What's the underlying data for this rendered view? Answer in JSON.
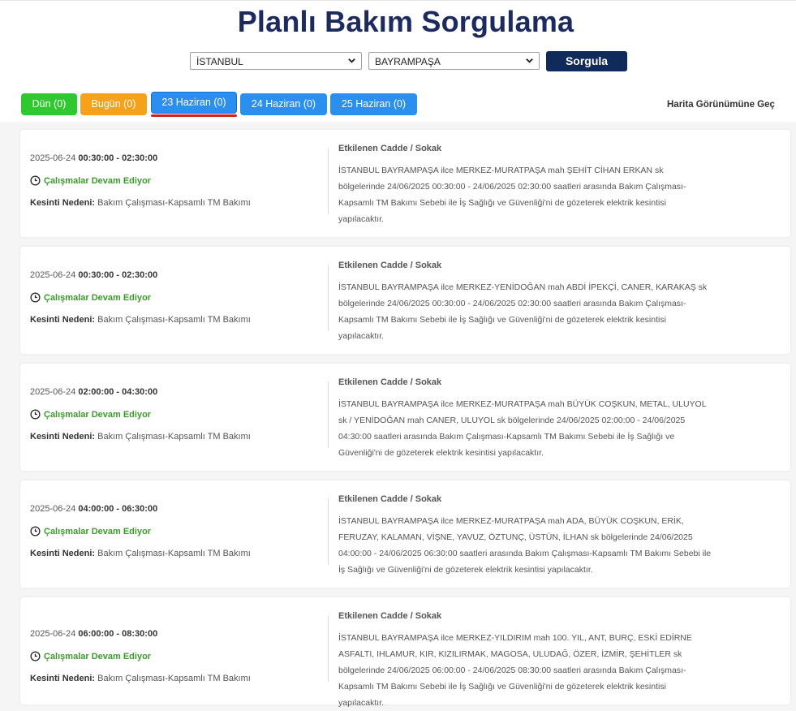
{
  "header": {
    "title": "Planlı Bakım Sorgulama"
  },
  "filters": {
    "province": "İSTANBUL",
    "district": "BAYRAMPAŞA",
    "query_button": "Sorgula"
  },
  "tabs": [
    {
      "label": "Dün (0)",
      "color": "#2fc92f"
    },
    {
      "label": "Bugün (0)",
      "color": "#f5a11a"
    },
    {
      "label": "23 Haziran (0)",
      "color": "#2b8ff0",
      "active": true
    },
    {
      "label": "24 Haziran (0)",
      "color": "#2b8ff0"
    },
    {
      "label": "25 Haziran (0)",
      "color": "#2b8ff0"
    }
  ],
  "map_link": "Harita Görünümüne Geç",
  "labels": {
    "affected_streets": "Etkilenen Cadde / Sokak",
    "reason_label": "Kesinti Nedeni:"
  },
  "outages": [
    {
      "date": "2025-06-24",
      "time": "00:30:00 - 02:30:00",
      "status": "Çalışmalar Devam Ediyor",
      "reason": "Bakım Çalışması-Kapsamlı TM Bakımı",
      "description": "İSTANBUL BAYRAMPAŞA ilce MERKEZ-MURATPAŞA mah ŞEHİT CİHAN ERKAN sk bölgelerinde 24/06/2025 00:30:00 - 24/06/2025 02:30:00 saatleri arasında Bakım Çalışması-Kapsamlı TM Bakımı Sebebi ile İş Sağlığı ve Güvenliği'ni de gözeterek elektrik kesintisi yapılacaktır."
    },
    {
      "date": "2025-06-24",
      "time": "00:30:00 - 02:30:00",
      "status": "Çalışmalar Devam Ediyor",
      "reason": "Bakım Çalışması-Kapsamlı TM Bakımı",
      "description": "İSTANBUL BAYRAMPAŞA ilce MERKEZ-YENİDOĞAN mah ABDİ İPEKÇİ, CANER, KARAKAŞ sk bölgelerinde 24/06/2025 00:30:00 - 24/06/2025 02:30:00 saatleri arasında Bakım Çalışması-Kapsamlı TM Bakımı Sebebi ile İş Sağlığı ve Güvenliği'ni de gözeterek elektrik kesintisi yapılacaktır."
    },
    {
      "date": "2025-06-24",
      "time": "02:00:00 - 04:30:00",
      "status": "Çalışmalar Devam Ediyor",
      "reason": "Bakım Çalışması-Kapsamlı TM Bakımı",
      "description": "İSTANBUL BAYRAMPAŞA ilce MERKEZ-MURATPAŞA mah BÜYÜK COŞKUN, METAL, ULUYOL sk / YENİDOĞAN mah CANER, ULUYOL sk bölgelerinde 24/06/2025 02:00:00 - 24/06/2025 04:30:00 saatleri arasında Bakım Çalışması-Kapsamlı TM Bakımı Sebebi ile İş Sağlığı ve Güvenliği'ni de gözeterek elektrik kesintisi yapılacaktır."
    },
    {
      "date": "2025-06-24",
      "time": "04:00:00 - 06:30:00",
      "status": "Çalışmalar Devam Ediyor",
      "reason": "Bakım Çalışması-Kapsamlı TM Bakımı",
      "description": "İSTANBUL BAYRAMPAŞA ilce MERKEZ-MURATPAŞA mah ADA, BÜYÜK COŞKUN, ERİK, FERUZAY, KALAMAN, VİŞNE, YAVUZ, ÖZTUNÇ, ÜSTÜN, İLHAN sk bölgelerinde 24/06/2025 04:00:00 - 24/06/2025 06:30:00 saatleri arasında Bakım Çalışması-Kapsamlı TM Bakımı Sebebi ile İş Sağlığı ve Güvenliği'ni de gözeterek elektrik kesintisi yapılacaktır."
    },
    {
      "date": "2025-06-24",
      "time": "06:00:00 - 08:30:00",
      "status": "Çalışmalar Devam Ediyor",
      "reason": "Bakım Çalışması-Kapsamlı TM Bakımı",
      "description": "İSTANBUL BAYRAMPAŞA ilce MERKEZ-YILDIRIM mah 100. YIL, ANT, BURÇ, ESKİ EDİRNE ASFALTI, IHLAMUR, KIR, KIZILIRMAK, MAGOSA, ULUDAĞ, ÖZER, İZMİR, ŞEHİTLER sk bölgelerinde 24/06/2025 06:00:00 - 24/06/2025 08:30:00 saatleri arasında Bakım Çalışması-Kapsamlı TM Bakımı Sebebi ile İş Sağlığı ve Güvenliği'ni de gözeterek elektrik kesintisi yapılacaktır."
    }
  ]
}
